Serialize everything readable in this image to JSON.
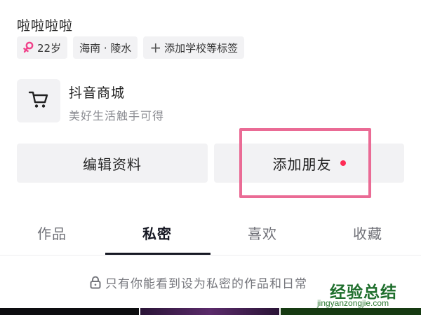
{
  "profile": {
    "name": "啦啦啦啦",
    "tags": {
      "age": "22岁",
      "location": "海南 · 陵水",
      "add_school": "添加学校等标签"
    }
  },
  "shop": {
    "title": "抖音商城",
    "subtitle": "美好生活触手可得"
  },
  "actions": {
    "edit_profile": "编辑资料",
    "add_friend": "添加朋友"
  },
  "tabs": [
    {
      "label": "作品",
      "active": false
    },
    {
      "label": "私密",
      "active": true
    },
    {
      "label": "喜欢",
      "active": false
    },
    {
      "label": "收藏",
      "active": false
    }
  ],
  "private_note": "只有你能看到设为私密的作品和日常",
  "watermark": {
    "main": "经验总结",
    "sub": "jingyanzongjie.com"
  },
  "colors": {
    "notification_dot": "#fe2c55",
    "highlight_border": "#ea6b95",
    "female_symbol": "#f0428a"
  },
  "icons": {
    "age_tag": "female-symbol-icon",
    "shop": "shopping-cart-icon",
    "private_note": "lock-icon",
    "add_tag": "plus-icon"
  }
}
